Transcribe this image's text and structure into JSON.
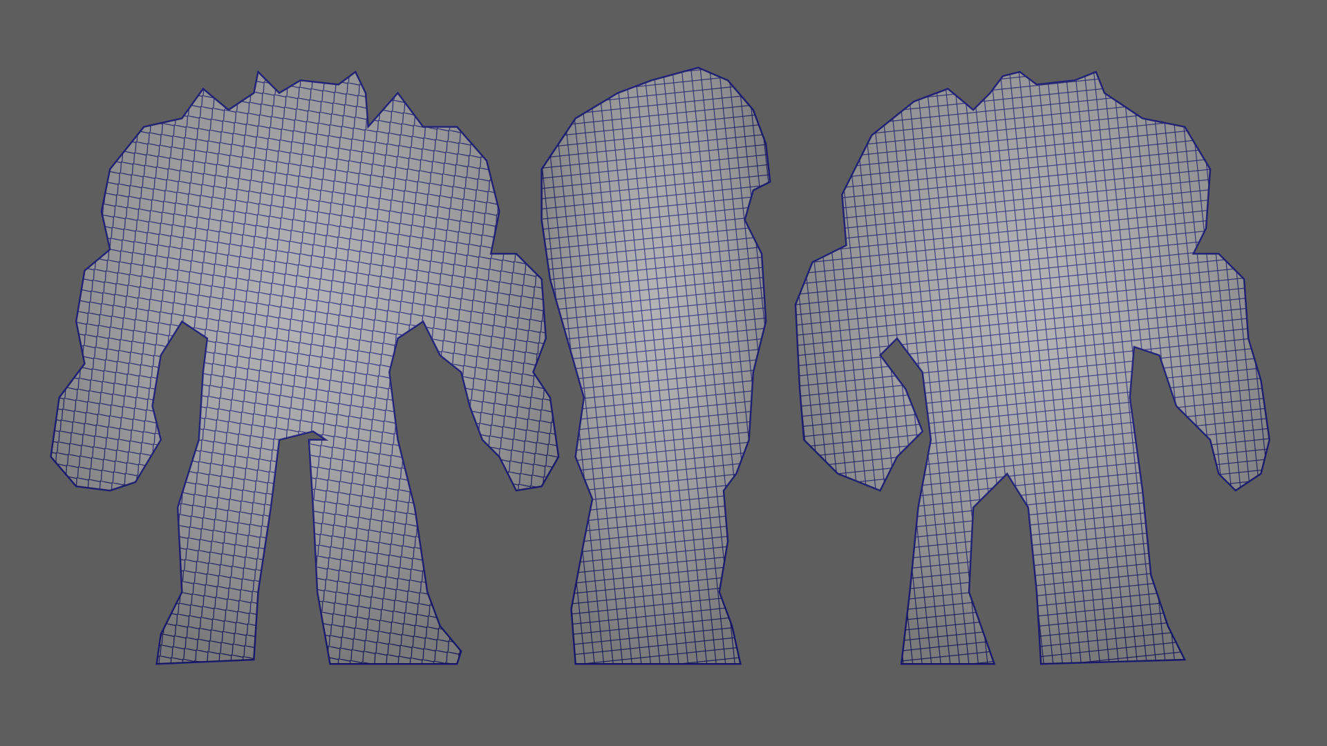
{
  "colors": {
    "background": "#5e5e5e",
    "surface": "#a9a9ab",
    "wireframe": "#1c1c7c"
  }
}
